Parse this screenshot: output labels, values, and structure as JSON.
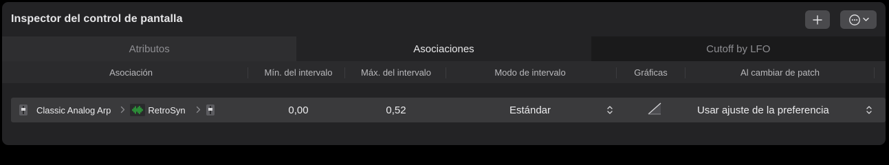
{
  "header": {
    "title": "Inspector del control de pantalla",
    "add_icon": "plus-icon",
    "more_icon": "ellipsis-circle-icon",
    "more_chevron_icon": "chevron-down-icon"
  },
  "tabs": [
    {
      "label": "Atributos",
      "active": false
    },
    {
      "label": "Asociaciones",
      "active": true
    },
    {
      "label": "Cutoff by LFO",
      "active": false
    }
  ],
  "columns": {
    "association": "Asociación",
    "range_min": "Mín. del intervalo",
    "range_max": "Máx. del intervalo",
    "range_mode": "Modo de intervalo",
    "graphics": "Gráficas",
    "on_patch_change": "Al cambiar de patch"
  },
  "rows": [
    {
      "path": {
        "instrument": "Classic Analog Arp",
        "plugin": "RetroSyn",
        "instrument_icon": "fader-icon",
        "plugin_icon": "waveform-icon",
        "target_icon": "fader-icon"
      },
      "range_min": "0,00",
      "range_max": "0,52",
      "range_mode": "Estándar",
      "graphics_icon": "linear-ramp-icon",
      "on_patch_change": "Usar ajuste de la preferencia"
    }
  ],
  "colors": {
    "background": "#000000",
    "panel": "#232325",
    "row": "#3a3a3c",
    "accent_wave": "#2ecc40"
  }
}
